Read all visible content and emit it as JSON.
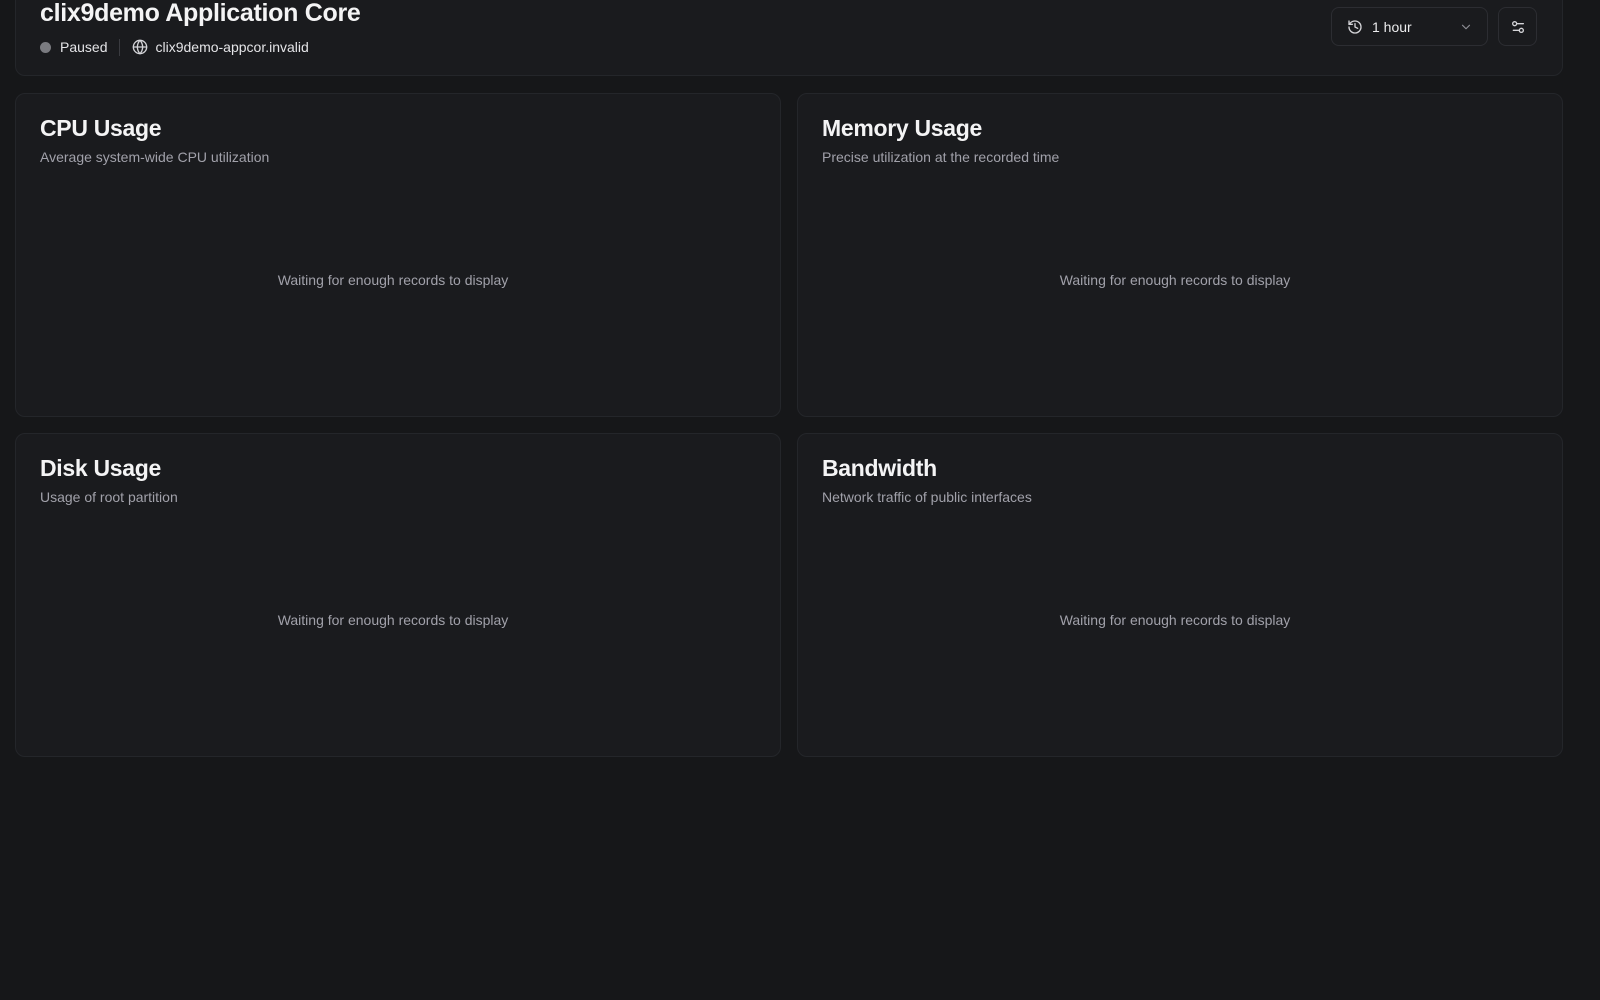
{
  "header": {
    "title": "clix9demo Application Core",
    "status": "Paused",
    "host": "clix9demo-appcor.invalid",
    "status_color": "#7a7b80",
    "icons": {
      "host": "globe-icon",
      "time_range": "history-icon",
      "dropdown": "chevron-down-icon",
      "settings": "sliders-icon"
    }
  },
  "time_range": {
    "selected": "1 hour"
  },
  "cards": [
    {
      "title": "CPU Usage",
      "subtitle": "Average system-wide CPU utilization",
      "empty": "Waiting for enough records to display"
    },
    {
      "title": "Memory Usage",
      "subtitle": "Precise utilization at the recorded time",
      "empty": "Waiting for enough records to display"
    },
    {
      "title": "Disk Usage",
      "subtitle": "Usage of root partition",
      "empty": "Waiting for enough records to display"
    },
    {
      "title": "Bandwidth",
      "subtitle": "Network traffic of public interfaces",
      "empty": "Waiting for enough records to display"
    }
  ]
}
